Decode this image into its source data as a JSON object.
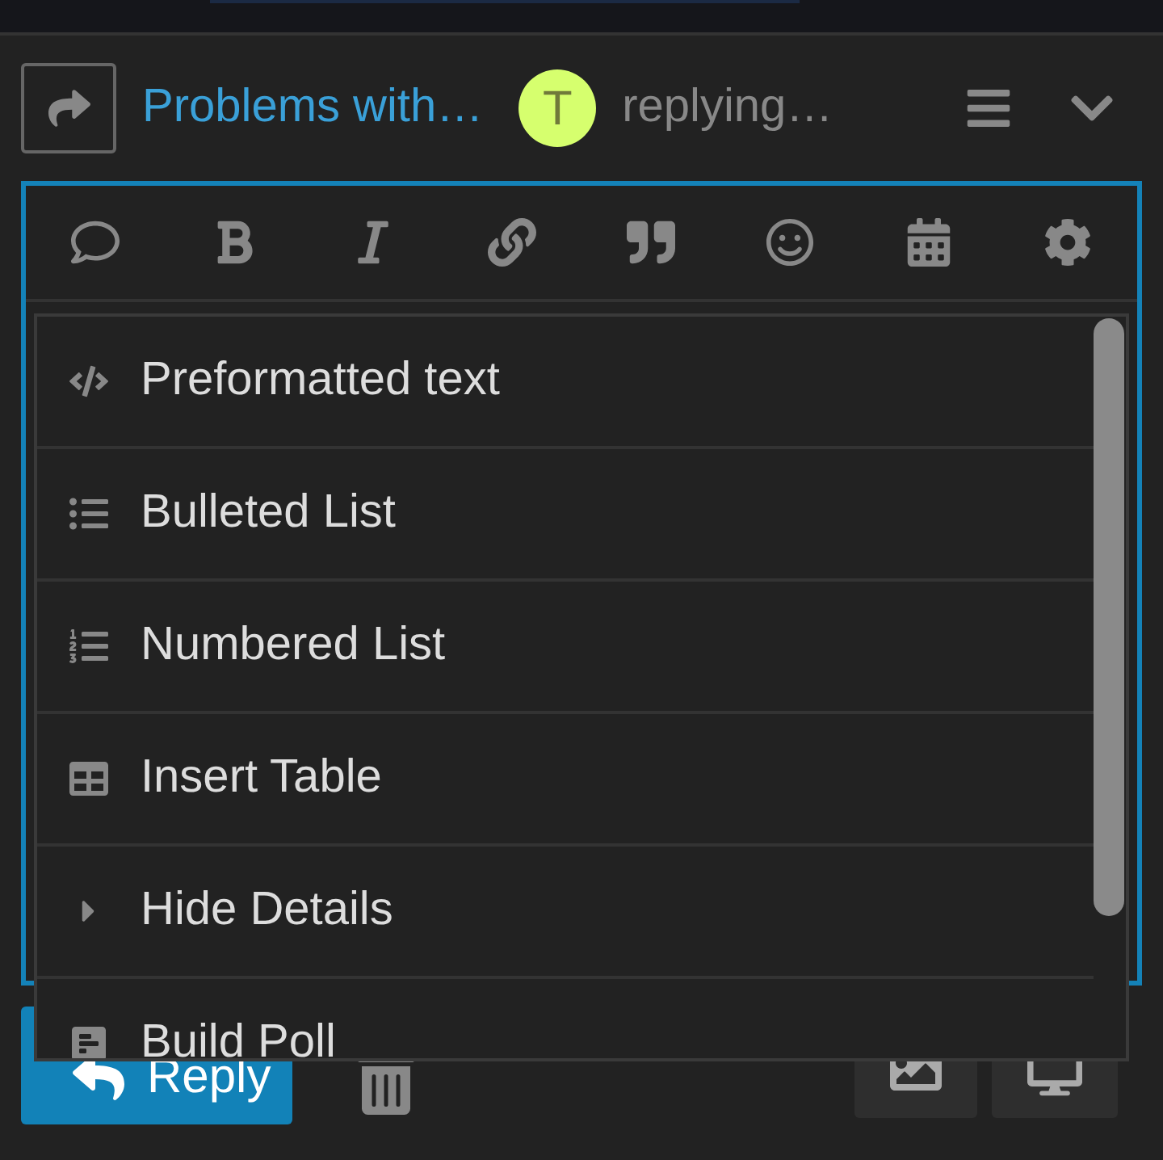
{
  "header": {
    "title": "Problems with…",
    "avatar_letter": "T",
    "status": "replying…"
  },
  "menu": {
    "items": [
      {
        "kind": "code",
        "label": "Preformatted text"
      },
      {
        "kind": "bullets",
        "label": "Bulleted List"
      },
      {
        "kind": "numbers",
        "label": "Numbered List"
      },
      {
        "kind": "table",
        "label": "Insert Table"
      },
      {
        "kind": "details",
        "label": "Hide Details"
      },
      {
        "kind": "poll",
        "label": "Build Poll"
      }
    ]
  },
  "footer": {
    "reply_button": "Reply"
  }
}
